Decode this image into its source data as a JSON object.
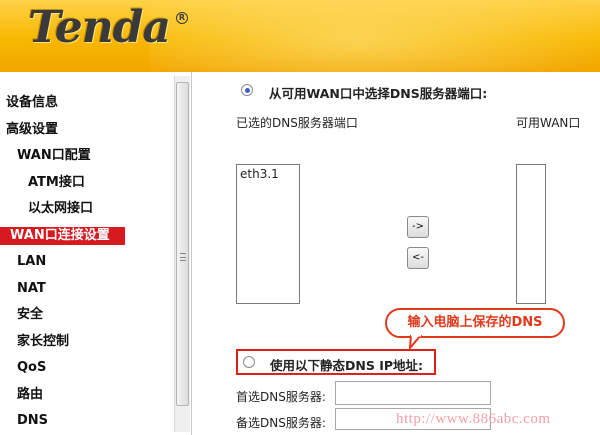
{
  "brand": {
    "logo_text": "Tenda",
    "reg_mark": "R"
  },
  "sidebar": {
    "items": [
      {
        "label": "设备信息",
        "level": 0
      },
      {
        "label": "高级设置",
        "level": 0
      },
      {
        "label": "WAN口配置",
        "level": 1
      },
      {
        "label": "ATM接口",
        "level": 2
      },
      {
        "label": "以太网接口",
        "level": 2
      },
      {
        "label": "WAN口连接设置",
        "level": 1,
        "active": true
      },
      {
        "label": "LAN",
        "level": 1
      },
      {
        "label": "NAT",
        "level": 1
      },
      {
        "label": "安全",
        "level": 1
      },
      {
        "label": "家长控制",
        "level": 1
      },
      {
        "label": "QoS",
        "level": 1
      },
      {
        "label": "路由",
        "level": 1
      },
      {
        "label": "DNS",
        "level": 1
      }
    ]
  },
  "dns": {
    "option_wan_label": "从可用WAN口中选择DNS服务器端口:",
    "option_wan_selected": true,
    "selected_ports_label": "已选的DNS服务器端口",
    "available_ports_label": "可用WAN口",
    "selected_ports": [
      "eth3.1"
    ],
    "available_ports": [],
    "move_right_label": "->",
    "move_left_label": "<-",
    "option_static_label": "使用以下静态DNS IP地址:",
    "option_static_selected": false,
    "primary_dns_label": "首选DNS服务器:",
    "primary_dns_value": "",
    "secondary_dns_label": "备选DNS服务器:",
    "secondary_dns_value": ""
  },
  "annotation": {
    "callout_text": "输入电脑上保存的DNS"
  },
  "watermark": "http://www.886abc.com",
  "colors": {
    "header": "#f7b800",
    "active_nav": "#d71920",
    "callout": "#e03a1b"
  }
}
